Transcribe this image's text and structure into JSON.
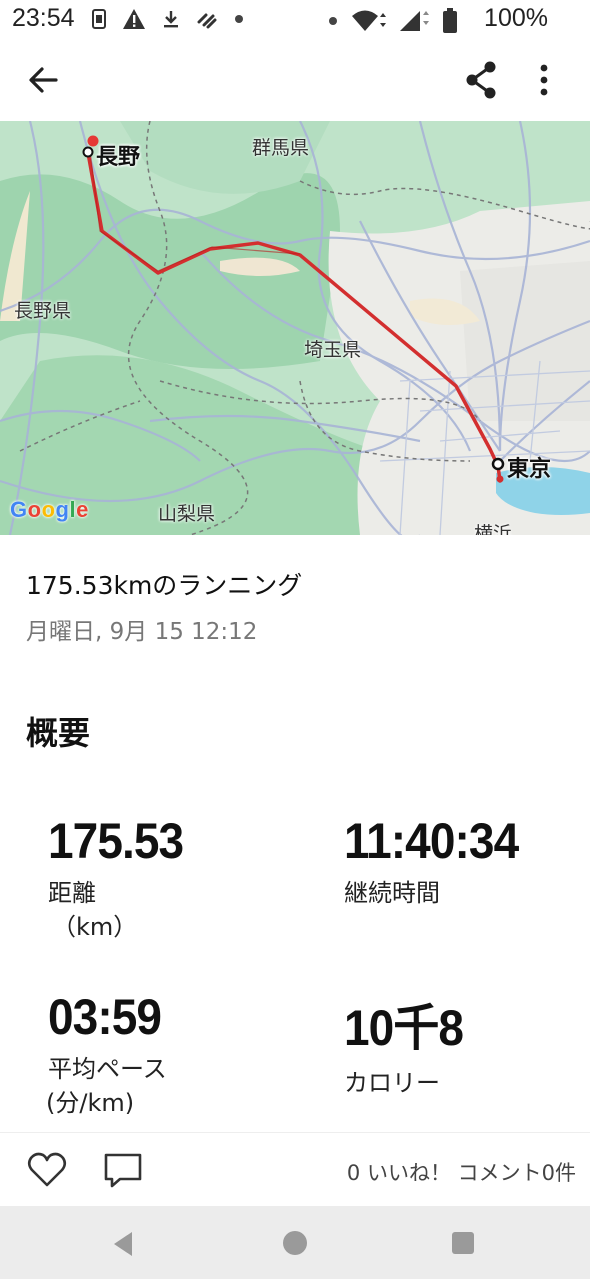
{
  "status_bar": {
    "time": "23:54",
    "battery_text": "100%",
    "icons_left": [
      "sim-card-icon",
      "warning-icon",
      "download-icon",
      "link-icon",
      "dot-icon"
    ],
    "icons_right": [
      "dot-icon",
      "wifi-icon",
      "signal-icon",
      "battery-icon"
    ]
  },
  "app_bar": {
    "back_icon": "arrow-left-icon",
    "share_icon": "share-icon",
    "more_icon": "more-vertical-icon"
  },
  "map": {
    "labels": {
      "nagano_city": "長野",
      "gunma": "群馬県",
      "nagano_pref": "長野県",
      "saitama": "埼玉県",
      "tokyo": "東京",
      "yamanashi": "山梨県",
      "yokohama": "横浜"
    },
    "attribution": "Google",
    "route_color": "#d32f2f"
  },
  "activity": {
    "title": "175.53kmのランニング",
    "date": "月曜日, 9月 15 12:12"
  },
  "overview": {
    "section_title": "概要",
    "stats": {
      "distance": {
        "value": "175.53",
        "label": "距離",
        "unit": "（km）"
      },
      "duration": {
        "value": "11:40:34",
        "label": "継続時間"
      },
      "pace": {
        "value": "03:59",
        "label": "平均ペース",
        "unit": "(分/km)"
      },
      "calories": {
        "value": "10千8",
        "label": "カロリー"
      }
    }
  },
  "actions": {
    "like_icon": "heart-icon",
    "comment_icon": "comment-icon",
    "counts_text": "0 いいね！ コメント0件"
  },
  "nav_bar": {
    "icons": [
      "nav-back-icon",
      "nav-home-icon",
      "nav-recents-icon"
    ]
  }
}
